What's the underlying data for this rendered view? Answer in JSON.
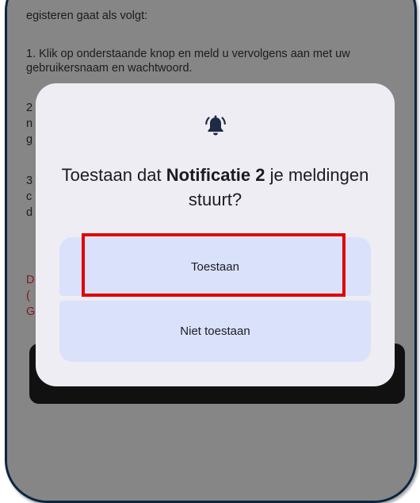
{
  "background_page": {
    "paragraphs": [
      "egisteren gaat als volgt:",
      "1. Klik op onderstaande knop en meld u vervolgens aan met uw gebruikersnaam en wachtwoord.",
      "2",
      "n",
      "g",
      "3",
      "c",
      "d"
    ],
    "red_fragments": [
      "D",
      "(",
      "G"
    ]
  },
  "dialog": {
    "icon": "bell-ringing-icon",
    "title_prefix": "Toestaan dat ",
    "title_app": "Notificatie 2",
    "title_suffix": " je meldingen stuurt?",
    "allow_label": "Toestaan",
    "deny_label": "Niet toestaan"
  },
  "colors": {
    "dialog_bg": "#eeedf4",
    "button_bg": "#dae1fb",
    "highlight": "#e00000",
    "scrim": "#868686"
  }
}
